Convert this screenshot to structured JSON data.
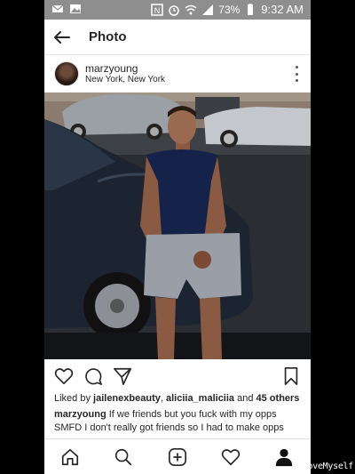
{
  "status_bar": {
    "battery": "73%",
    "time": "9:32 AM"
  },
  "header": {
    "title": "Photo"
  },
  "post": {
    "username": "marzyoung",
    "location": "New York, New York",
    "likes_prefix": "Liked by ",
    "liker_1": "jailenexbeauty",
    "separator": ", ",
    "liker_2": "aliciia_maliciia",
    "and_text": " and ",
    "others": "45 others",
    "caption_user": "marzyoung",
    "caption_text": " If we friends but you fuck with my opps SMFD I don't really got friends so I had to make opps"
  },
  "icons": {
    "back": "arrow-left-icon",
    "more": "more-vertical-icon",
    "like": "heart-icon",
    "comment": "comment-icon",
    "share": "send-icon",
    "save": "bookmark-icon",
    "home": "home-icon",
    "search": "search-icon",
    "add": "plus-square-icon",
    "activity": "heart-icon",
    "profile": "profile-icon"
  },
  "watermark": "ProveMyself"
}
